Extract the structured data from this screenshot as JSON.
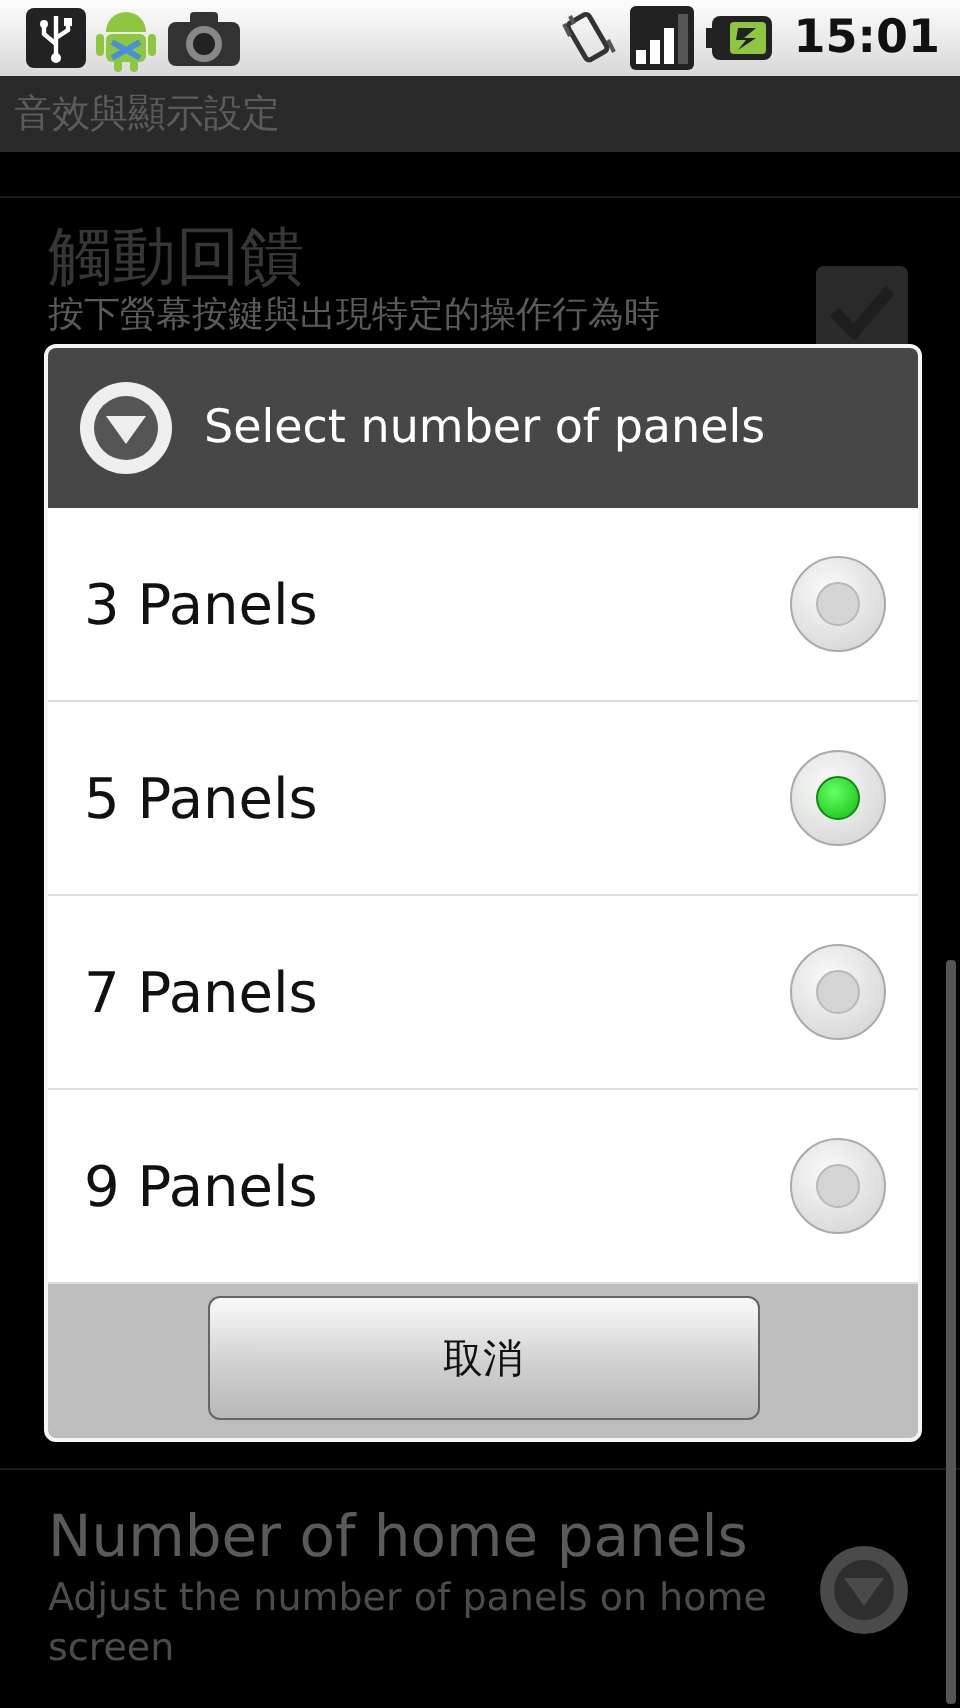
{
  "status_bar": {
    "time": "15:01"
  },
  "header": {
    "title": "音效與顯示設定"
  },
  "settings": [
    {
      "kind": "checkbox",
      "title": "觸動回饋",
      "summary": "按下螢幕按鍵與出現特定的操作行為時",
      "checked": true
    },
    {
      "kind": "list",
      "title": "Number of home panels",
      "summary": "Adjust the number of panels on home screen"
    }
  ],
  "dialog": {
    "title": "Select number of panels",
    "options": [
      {
        "label": "3 Panels",
        "selected": false
      },
      {
        "label": "5 Panels",
        "selected": true
      },
      {
        "label": "7 Panels",
        "selected": false
      },
      {
        "label": "9 Panels",
        "selected": false
      }
    ],
    "cancel": "取消"
  }
}
